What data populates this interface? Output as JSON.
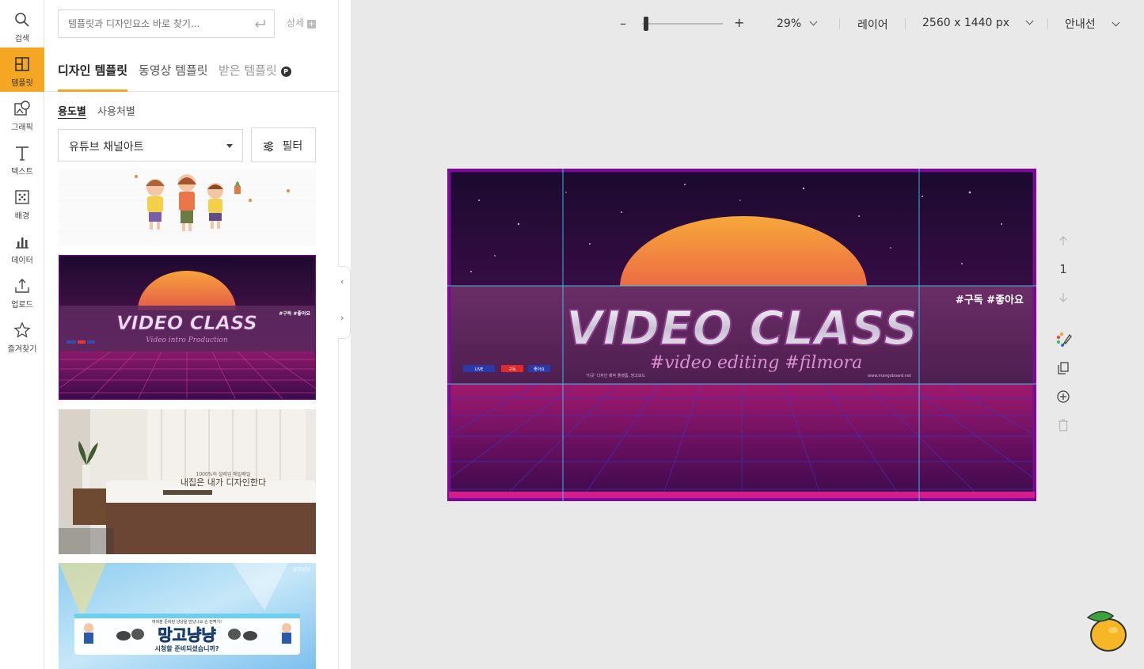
{
  "rail": {
    "items": [
      {
        "label": "검색",
        "icon": "search-icon"
      },
      {
        "label": "템플릿",
        "icon": "template-icon",
        "active": true
      },
      {
        "label": "그래픽",
        "icon": "graphic-icon"
      },
      {
        "label": "텍스트",
        "icon": "text-icon"
      },
      {
        "label": "배경",
        "icon": "background-icon"
      },
      {
        "label": "데이터",
        "icon": "chart-icon"
      },
      {
        "label": "업로드",
        "icon": "upload-icon"
      },
      {
        "label": "즐겨찾기",
        "icon": "star-icon"
      }
    ],
    "accent": "#f5a623"
  },
  "panel": {
    "search": {
      "placeholder": "템플릿과 디자인요소 바로 찾기..."
    },
    "detail_label": "상세",
    "tabs": [
      {
        "label": "디자인 템플릿",
        "active": true
      },
      {
        "label": "동영상 템플릿"
      },
      {
        "label": "받은 템플릿",
        "badge": "P"
      }
    ],
    "subtabs": [
      {
        "label": "용도별",
        "active": true
      },
      {
        "label": "사용처별"
      }
    ],
    "category": {
      "value": "유튜브 채널아트"
    },
    "filter_label": "필터",
    "thumbs": [
      {
        "id": "kids"
      },
      {
        "id": "video-class",
        "title": "VIDEO CLASS",
        "subtitle": "Video intro Production",
        "tags": "#구독 #좋아요"
      },
      {
        "id": "bedroom",
        "line1": "1000%의 설레임 매일매일",
        "line2": "내집은 내가 디자인한다"
      },
      {
        "id": "mangonyang",
        "title": "망고냥냥",
        "top": "여러분 준비된 냥냥을 만났나요 손 번쩍기!",
        "bottom": "시청할 준비되셨습니까?",
        "corner": "망고냥냥"
      }
    ]
  },
  "topbar": {
    "zoom_minus": "–",
    "zoom_plus": "+",
    "zoom": "29%",
    "zoom_fraction": 0.29,
    "layer_label": "레이어",
    "size_label": "2560 x 1440 px",
    "guide_label": "안내선"
  },
  "canvas": {
    "title": "VIDEO CLASS",
    "subtitle": "#video editing #filmora",
    "tags": "#구독 #좋아요",
    "footer_left": "'이곳' 디자인 제작 플랫폼, 망고보드",
    "footer_right": "www.mangoboard.net",
    "badges": [
      "LIVE",
      "구독",
      "좋아요"
    ],
    "colors": {
      "sky_top": "#1a0a2e",
      "sky_mid": "#5a1060",
      "sun": "#f5912e",
      "band": "#5e2a60",
      "grid": "#c2185b",
      "border": "#7a0a9a"
    }
  },
  "side_tools": {
    "page_number": "1"
  }
}
